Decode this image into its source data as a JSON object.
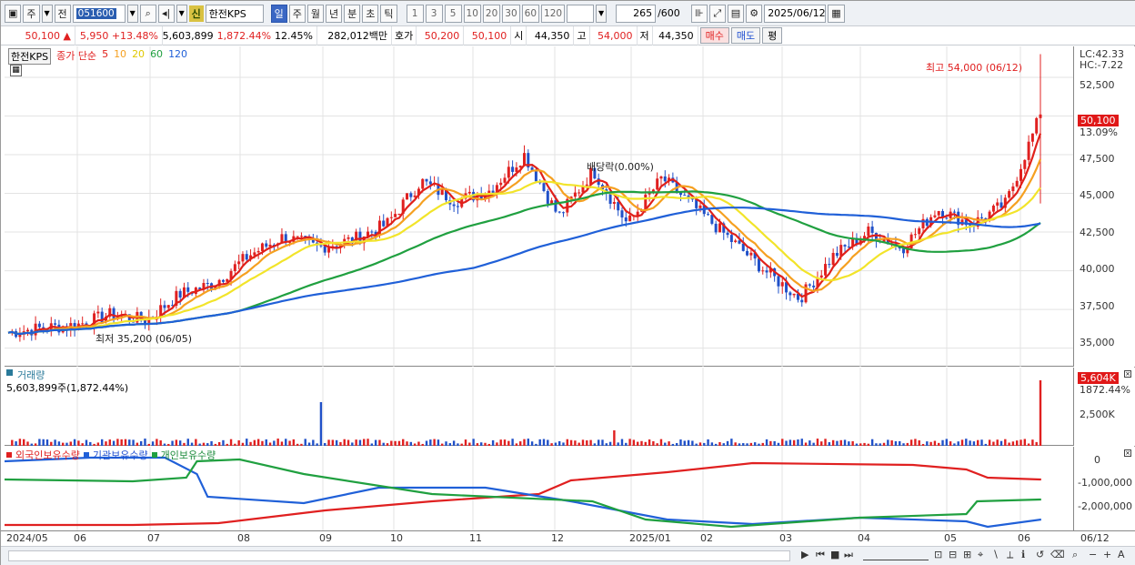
{
  "toolbar": {
    "market": "주",
    "prev_label": "전",
    "code": "051600",
    "name_badge": "신",
    "name": "한전KPS",
    "periods": [
      "일",
      "주",
      "월",
      "년",
      "분",
      "초",
      "틱"
    ],
    "active_period": "일",
    "intervals": [
      "1",
      "3",
      "5",
      "10",
      "20",
      "30",
      "60",
      "120"
    ],
    "count": "265",
    "count_total": "/600",
    "date": "2025/06/12"
  },
  "quote": {
    "price": "50,100",
    "arrow": "▲",
    "change": "5,950",
    "change_pct": "+13.48%",
    "volume": "5,603,899",
    "volume_ratio": "1,872.44%",
    "turnover": "12.45%",
    "amount": "282,012백만",
    "bid_label": "호가",
    "bid": "50,200",
    "bid2": "50,100",
    "open_label": "시",
    "open": "44,350",
    "high_label": "고",
    "high": "54,000",
    "low_label": "저",
    "low": "44,350",
    "buy_label": "매수",
    "sell_label": "매도",
    "eval_label": "평"
  },
  "price_pane": {
    "legend_name": "한전KPS",
    "legend_ma_label": "종가 단순",
    "ma": [
      {
        "period": "5",
        "color": "#e0201a"
      },
      {
        "period": "10",
        "color": "#f5a020"
      },
      {
        "period": "20",
        "color": "#f2e42a"
      },
      {
        "period": "60",
        "color": "#20a040"
      },
      {
        "period": "120",
        "color": "#2060d8"
      }
    ],
    "lc": "LC:42.33",
    "hc": "HC:-7.22",
    "current": "50,100",
    "current_pct": "13.09%",
    "high_note": "최고 54,000 (06/12)",
    "low_note": "최저 35,200 (06/05)",
    "dividend_note": "배당락(0.00%)",
    "ticks": [
      "52,500",
      "50,000",
      "47,500",
      "45,000",
      "42,500",
      "40,000",
      "37,500",
      "35,000"
    ]
  },
  "volume_pane": {
    "title": "거래량",
    "value": "5,603,899주(1,872.44%)",
    "box": "5,604K",
    "box_pct": "1872.44%",
    "ticks": [
      "2,500K"
    ],
    "bar_color_up": "#e02020",
    "bar_color_down": "#2050c8"
  },
  "holdings_pane": {
    "foreign": "외국인보유수량",
    "institution": "기관보유수량",
    "individual": "개인보유수량",
    "ticks": [
      "0",
      "-1,000,000",
      "-2,000,000"
    ]
  },
  "dates": [
    "2024/05",
    "06",
    "07",
    "08",
    "09",
    "10",
    "11",
    "12",
    "2025/01",
    "02",
    "03",
    "04",
    "05",
    "06"
  ],
  "date_axis_label": "06/12",
  "chart_data": {
    "type": "line",
    "title": "",
    "price_range": [
      33800,
      54500
    ],
    "series": [
      {
        "name": "한전KPS",
        "values": [
          36000,
          36300,
          36500,
          37200,
          36800,
          38500,
          39200,
          41000,
          42200,
          41500,
          42000,
          43000,
          45800,
          44500,
          45200,
          47500,
          43500,
          46500,
          43000,
          46000,
          44000,
          42000,
          40000,
          38200,
          41000,
          42500,
          41500,
          44000,
          43000,
          44350,
          50100
        ]
      }
    ]
  }
}
